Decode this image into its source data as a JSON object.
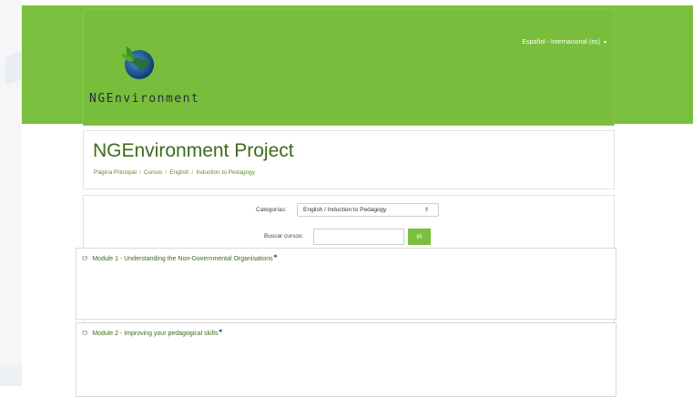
{
  "header": {
    "logo_text": "NGEnvironment",
    "language_label": "Español - Internacional (es)",
    "language_caret": "▾"
  },
  "page": {
    "title": "NGEnvironment Project",
    "breadcrumb": [
      "Página Principal",
      "Cursos",
      "English",
      "Induction to Pedagogy"
    ],
    "breadcrumb_separator": "/"
  },
  "filters": {
    "category_label": "Categorías:",
    "category_selected": "English / Induction to Pedagogy",
    "search_label": "Buscar cursos:",
    "search_value": "",
    "go_label": "IR"
  },
  "courses": [
    {
      "title": "Module 1 - Understanding the Non-Governmental Organisations"
    },
    {
      "title": "Module 2 - Improving your pedagogical skills"
    }
  ],
  "colors": {
    "brand_green": "#7bbf3e",
    "title_green": "#3f6b1a"
  }
}
